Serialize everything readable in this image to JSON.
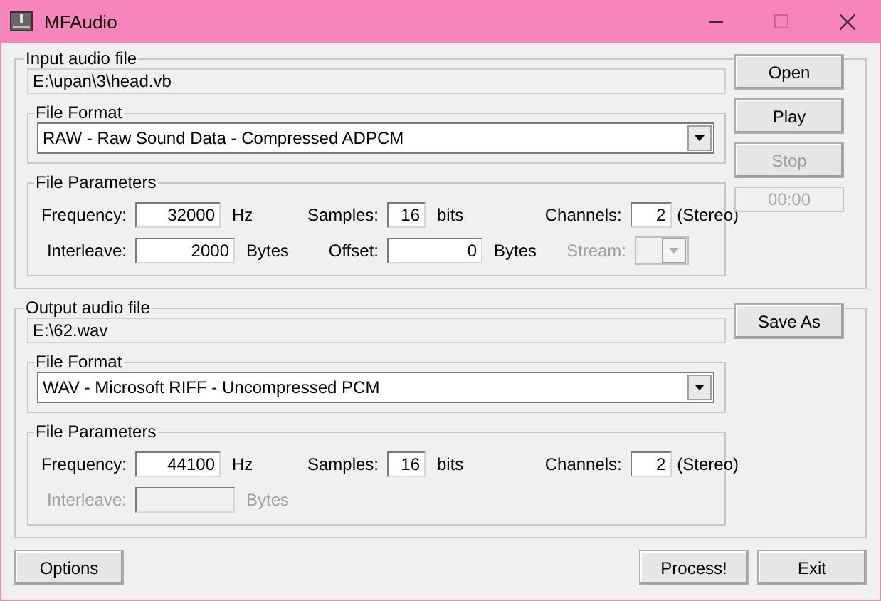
{
  "window": {
    "title": "MFAudio"
  },
  "sections": [
    {
      "title": "Input audio file",
      "path": "E:\\upan\\3\\head.vb",
      "format": {
        "title": "File Format",
        "value": "RAW - Raw Sound Data - Compressed ADPCM"
      },
      "params": {
        "title": "File Parameters",
        "rows": [
          [
            {
              "kind": "text",
              "label": "Frequency:",
              "value": "32000",
              "unit": "Hz",
              "disabled": false
            },
            {
              "kind": "text",
              "label": "Samples:",
              "value": "16",
              "unit": "bits",
              "disabled": false
            },
            {
              "kind": "text",
              "label": "Channels:",
              "value": "2",
              "unit": "(Stereo)",
              "disabled": false
            }
          ],
          [
            {
              "kind": "text",
              "label": "Interleave:",
              "value": "2000",
              "unit": "Bytes",
              "disabled": false
            },
            {
              "kind": "text",
              "label": "Offset:",
              "value": "0",
              "unit": "Bytes",
              "disabled": false
            },
            {
              "kind": "combo",
              "label": "Stream:",
              "disabled": true
            }
          ]
        ]
      },
      "side": [
        {
          "kind": "button",
          "label": "Open",
          "disabled": false
        },
        {
          "kind": "button",
          "label": "Play",
          "disabled": false
        },
        {
          "kind": "button",
          "label": "Stop",
          "disabled": true
        },
        {
          "kind": "display",
          "label": "00:00",
          "disabled": true
        }
      ]
    },
    {
      "title": "Output audio file",
      "path": "E:\\62.wav",
      "format": {
        "title": "File Format",
        "value": "WAV - Microsoft RIFF - Uncompressed PCM"
      },
      "params": {
        "title": "File Parameters",
        "rows": [
          [
            {
              "kind": "text",
              "label": "Frequency:",
              "value": "44100",
              "unit": "Hz",
              "disabled": false
            },
            {
              "kind": "text",
              "label": "Samples:",
              "value": "16",
              "unit": "bits",
              "disabled": false
            },
            {
              "kind": "text",
              "label": "Channels:",
              "value": "2",
              "unit": "(Stereo)",
              "disabled": false
            }
          ],
          [
            {
              "kind": "text",
              "label": "Interleave:",
              "unit": "Bytes",
              "disabled": true
            }
          ]
        ]
      },
      "side": [
        {
          "kind": "button",
          "label": "Save As",
          "disabled": false
        }
      ]
    }
  ],
  "footer": {
    "left": [
      {
        "label": "Options"
      }
    ],
    "right": [
      {
        "label": "Process!"
      },
      {
        "label": "Exit"
      }
    ]
  }
}
